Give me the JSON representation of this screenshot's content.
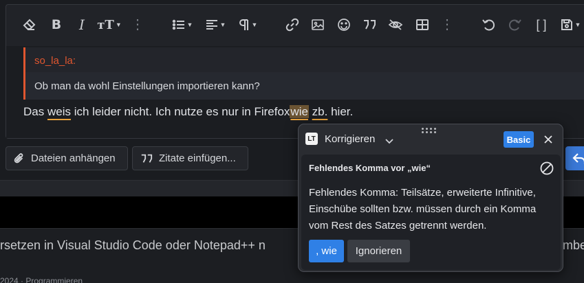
{
  "toolbar": {
    "buttons": [
      "eraser-icon",
      "bold-icon",
      "italic-icon",
      "text-size-icon",
      "more-icon",
      "list-icon",
      "align-icon",
      "paragraph-icon",
      "more-icon",
      "link-icon",
      "image-icon",
      "emoji-icon",
      "quote-icon",
      "spoiler-icon",
      "table-icon",
      "more-icon",
      "undo-icon",
      "redo-icon",
      "brackets-icon",
      "save-icon"
    ],
    "text_size_label": "тТ",
    "more_dots": "⋮",
    "brackets_label": "[ ]"
  },
  "quote": {
    "author": "so_la_la:",
    "text": "Ob man da wohl Einstellungen importieren kann?"
  },
  "message": {
    "part1": "Das ",
    "word_weis": "weis",
    "part2": " ich leider nicht. Ich nutze es nur in Firefox",
    "word_wie": "wie",
    "part3": " ",
    "word_zb": "zb.",
    "part4": " hier."
  },
  "actions": {
    "attach_label": "Dateien anhängen",
    "quotes_label": "Zitate einfügen..."
  },
  "thread": {
    "title": "rsetzen in Visual Studio Code oder Notepad++ n",
    "title_right": "mber",
    "meta": "2024 · Programmieren"
  },
  "popup": {
    "logo": "LT",
    "title": "Korrigieren",
    "badge": "Basic",
    "card_title": "Fehlendes Komma vor „wie“",
    "card_body": "Fehlendes Komma: Teilsätze, erweiterte Infinitive, Einschübe sollten bzw. müssen durch ein Komma vom Rest des Satzes getrennt werden.",
    "suggestion": ", wie",
    "ignore_label": "Ignorieren"
  },
  "colors": {
    "accent": "#2f80e6",
    "quote_border": "#e0562f",
    "underline": "#e9a23b"
  }
}
